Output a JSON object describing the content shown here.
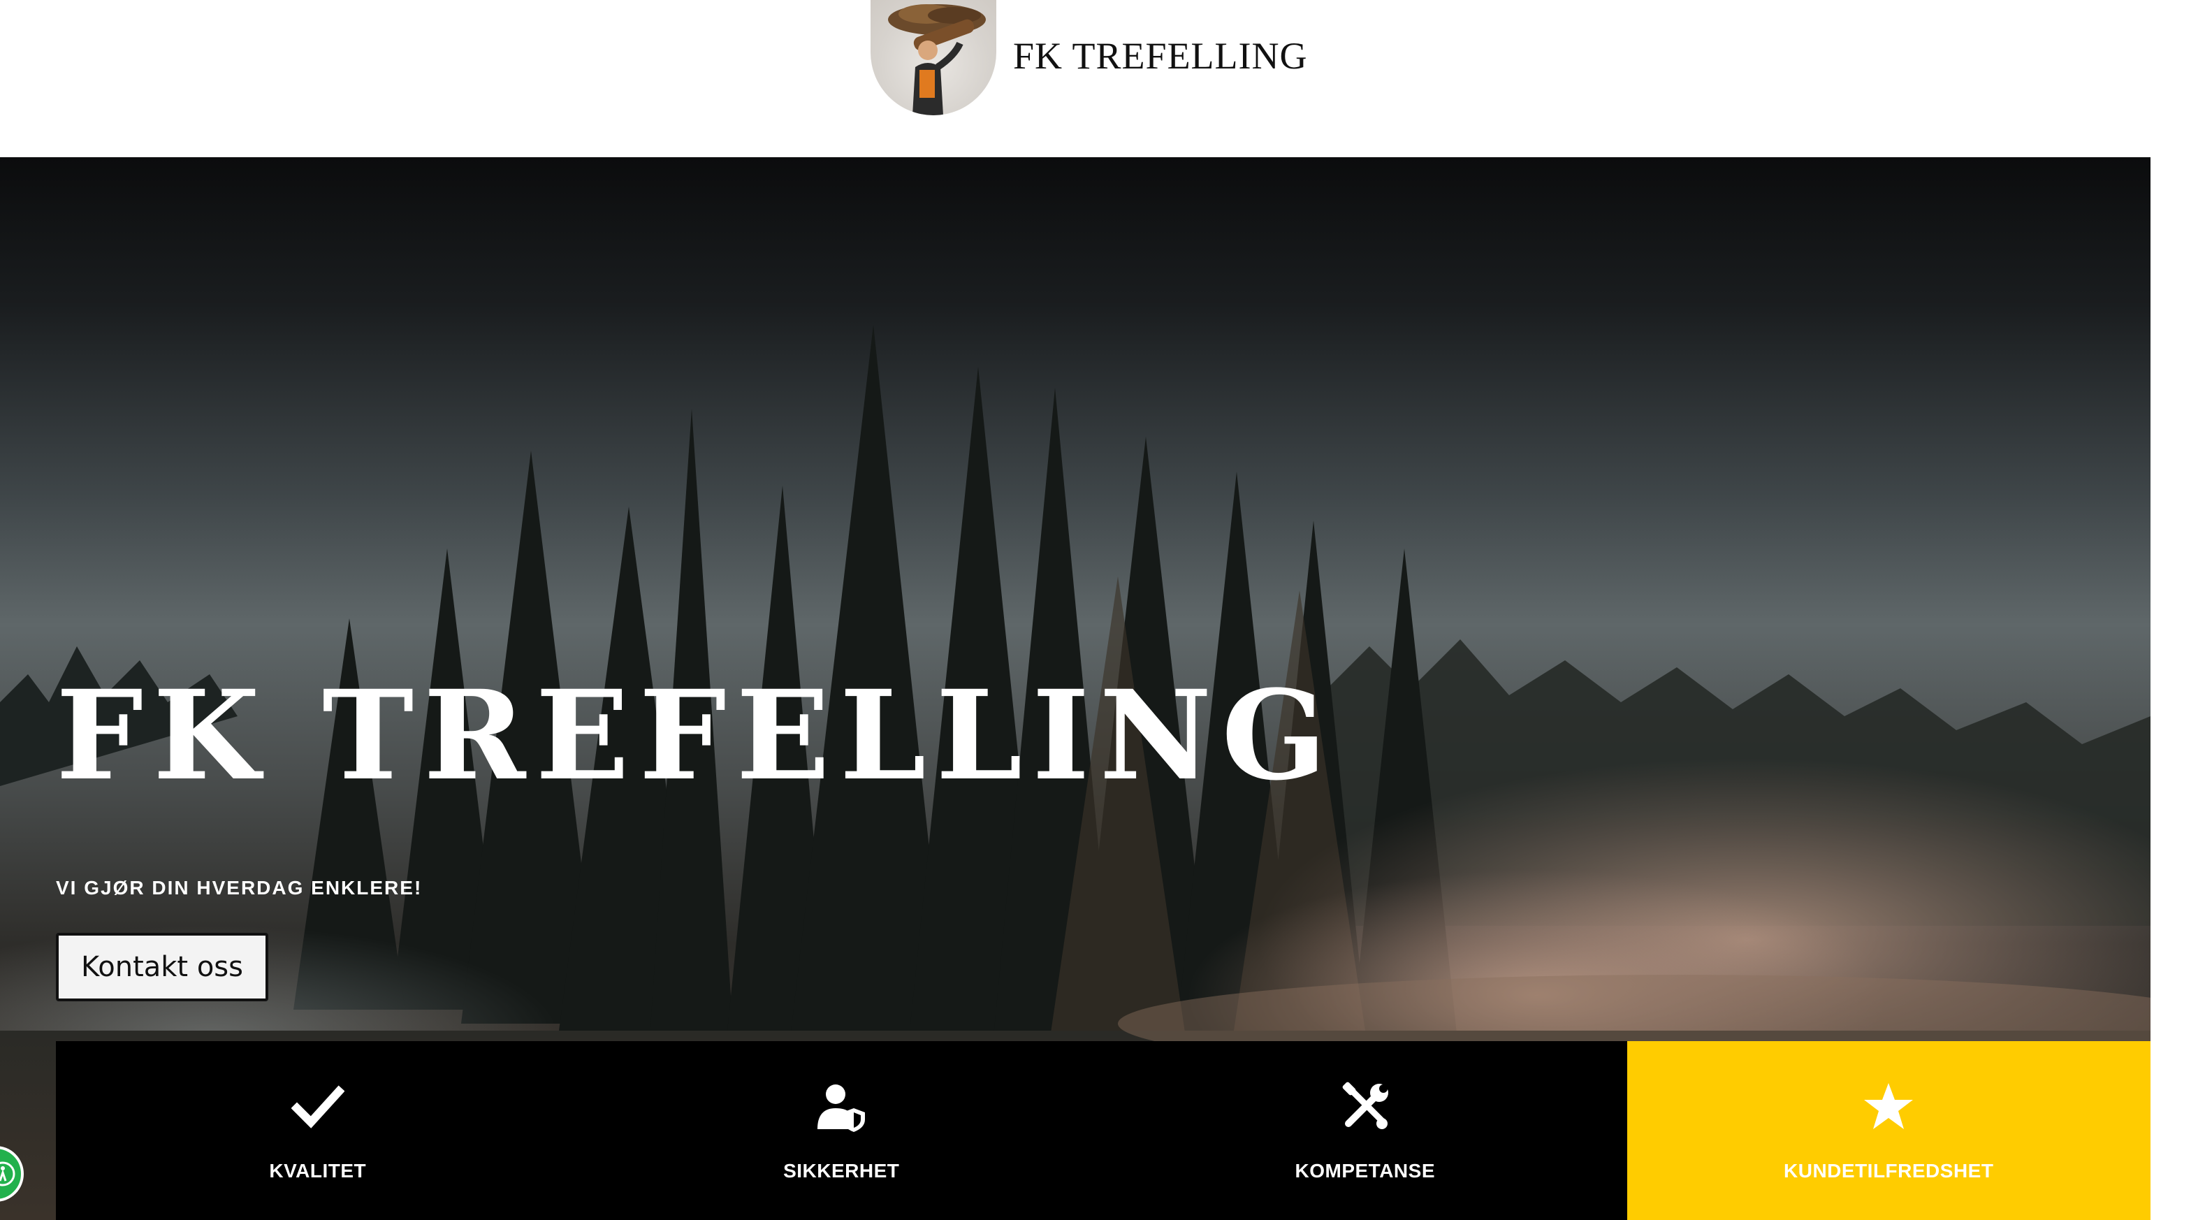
{
  "header": {
    "brand_name": "FK TREFELLING",
    "logo_icon": "lumberjack-logo-icon"
  },
  "hero": {
    "title": "FK TREFELLING",
    "subtitle": "VI GJØR DIN HVERDAG ENKLERE!",
    "cta_label": "Kontakt oss"
  },
  "features": [
    {
      "icon": "checkmark-icon",
      "label": "KVALITET"
    },
    {
      "icon": "user-shield-icon",
      "label": "SIKKERHET"
    },
    {
      "icon": "tools-icon",
      "label": "KOMPETANSE"
    },
    {
      "icon": "star-icon",
      "label": "KUNDETILFREDSHET"
    }
  ],
  "colors": {
    "highlight": "#ffcc00",
    "feature_bg": "#000000",
    "accessibility_button": "#22b14c"
  },
  "floating": {
    "icon": "accessibility-icon"
  }
}
